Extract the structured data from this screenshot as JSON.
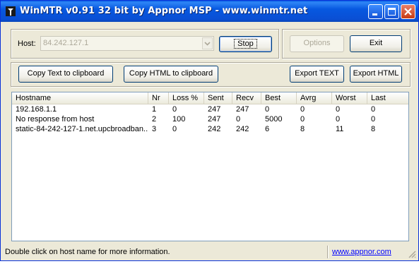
{
  "window": {
    "title": "WinMTR v0.91 32 bit by Appnor MSP - www.winmtr.net",
    "accent": "#0a5fe4"
  },
  "host": {
    "label": "Host:",
    "value": "84.242.127.1"
  },
  "buttons": {
    "stop": "Stop",
    "options": "Options",
    "exit": "Exit",
    "copy_text": "Copy Text to clipboard",
    "copy_html": "Copy HTML to clipboard",
    "export_text": "Export TEXT",
    "export_html": "Export HTML"
  },
  "table": {
    "columns": [
      "Hostname",
      "Nr",
      "Loss %",
      "Sent",
      "Recv",
      "Best",
      "Avrg",
      "Worst",
      "Last"
    ],
    "rows": [
      [
        "192.168.1.1",
        "1",
        "0",
        "247",
        "247",
        "0",
        "0",
        "0",
        "0"
      ],
      [
        "No response from host",
        "2",
        "100",
        "247",
        "0",
        "5000",
        "0",
        "0",
        "0"
      ],
      [
        "static-84-242-127-1.net.upcbroadban...",
        "3",
        "0",
        "242",
        "242",
        "6",
        "8",
        "11",
        "8"
      ]
    ]
  },
  "status": {
    "text": "Double click on host name for more information.",
    "link": "www.appnor.com"
  }
}
